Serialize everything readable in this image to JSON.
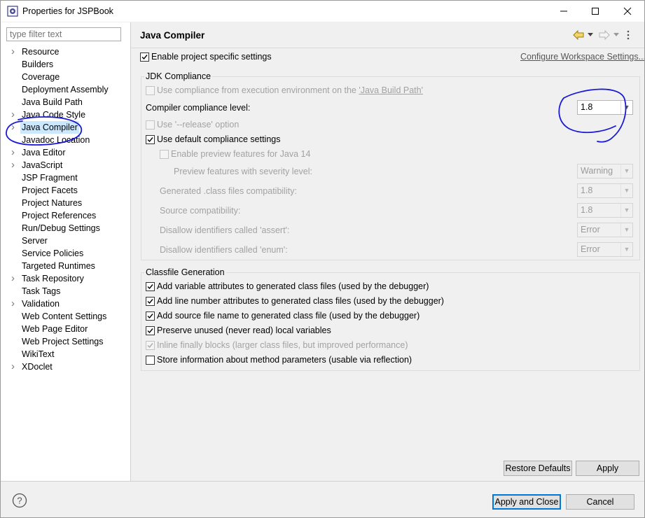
{
  "window": {
    "title": "Properties for JSPBook",
    "minimize_glyph": "—",
    "maximize_glyph": "☐",
    "close_glyph": "✕"
  },
  "sidebar": {
    "filter_placeholder": "type filter text",
    "items": [
      {
        "label": "Resource",
        "expandable": true
      },
      {
        "label": "Builders",
        "expandable": false
      },
      {
        "label": "Coverage",
        "expandable": false
      },
      {
        "label": "Deployment Assembly",
        "expandable": false
      },
      {
        "label": "Java Build Path",
        "expandable": false
      },
      {
        "label": "Java Code Style",
        "expandable": true
      },
      {
        "label": "Java Compiler",
        "expandable": true,
        "selected": true
      },
      {
        "label": "Javadoc Location",
        "expandable": false
      },
      {
        "label": "Java Editor",
        "expandable": true
      },
      {
        "label": "JavaScript",
        "expandable": true
      },
      {
        "label": "JSP Fragment",
        "expandable": false
      },
      {
        "label": "Project Facets",
        "expandable": false
      },
      {
        "label": "Project Natures",
        "expandable": false
      },
      {
        "label": "Project References",
        "expandable": false
      },
      {
        "label": "Run/Debug Settings",
        "expandable": false
      },
      {
        "label": "Server",
        "expandable": false
      },
      {
        "label": "Service Policies",
        "expandable": false
      },
      {
        "label": "Targeted Runtimes",
        "expandable": false
      },
      {
        "label": "Task Repository",
        "expandable": true
      },
      {
        "label": "Task Tags",
        "expandable": false
      },
      {
        "label": "Validation",
        "expandable": true
      },
      {
        "label": "Web Content Settings",
        "expandable": false
      },
      {
        "label": "Web Page Editor",
        "expandable": false
      },
      {
        "label": "Web Project Settings",
        "expandable": false
      },
      {
        "label": "WikiText",
        "expandable": false
      },
      {
        "label": "XDoclet",
        "expandable": true
      }
    ]
  },
  "page": {
    "title": "Java Compiler",
    "enable_project_specific": {
      "label": "Enable project specific settings",
      "checked": true
    },
    "configure_workspace_link": "Configure Workspace Settings...",
    "jdk_group": {
      "title": "JDK Compliance",
      "use_compliance_prefix": "Use compliance from execution environment on the ",
      "use_compliance_link": "'Java Build Path'",
      "compliance_level_label": "Compiler compliance level:",
      "compliance_level_value": "1.8",
      "release_option_label": "Use '--release' option",
      "use_default_label": "Use default compliance settings",
      "enable_preview_label": "Enable preview features for Java 14",
      "preview_severity_label": "Preview features with severity level:",
      "preview_severity_value": "Warning",
      "generated_class_label": "Generated .class files compatibility:",
      "generated_class_value": "1.8",
      "source_compat_label": "Source compatibility:",
      "source_compat_value": "1.8",
      "disallow_assert_label": "Disallow identifiers called 'assert':",
      "disallow_assert_value": "Error",
      "disallow_enum_label": "Disallow identifiers called 'enum':",
      "disallow_enum_value": "Error"
    },
    "classfile_group": {
      "title": "Classfile Generation",
      "options": [
        {
          "label": "Add variable attributes to generated class files (used by the debugger)",
          "checked": true,
          "enabled": true
        },
        {
          "label": "Add line number attributes to generated class files (used by the debugger)",
          "checked": true,
          "enabled": true
        },
        {
          "label": "Add source file name to generated class file (used by the debugger)",
          "checked": true,
          "enabled": true
        },
        {
          "label": "Preserve unused (never read) local variables",
          "checked": true,
          "enabled": true
        },
        {
          "label": "Inline finally blocks (larger class files, but improved performance)",
          "checked": true,
          "enabled": false
        },
        {
          "label": "Store information about method parameters (usable via reflection)",
          "checked": false,
          "enabled": true
        }
      ]
    },
    "restore_defaults": "Restore Defaults",
    "apply": "Apply"
  },
  "footer": {
    "help_glyph": "?",
    "apply_and_close": "Apply and Close",
    "cancel": "Cancel"
  },
  "annotation_color": "#1a1ad6"
}
